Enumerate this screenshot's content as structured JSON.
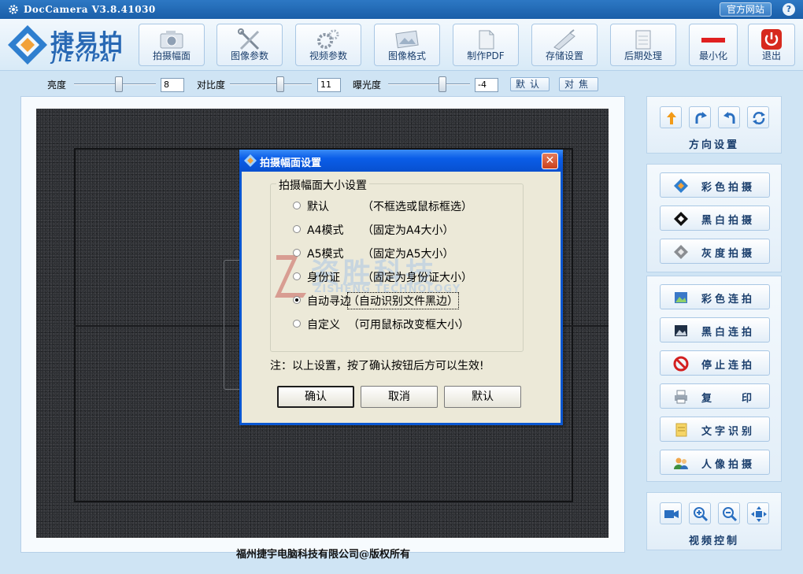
{
  "window": {
    "title": "DocCamera V3.8.41030",
    "official_site": "官方网站",
    "help": "?"
  },
  "logo": {
    "brand": "捷易拍",
    "sub": "JIEYIPAI"
  },
  "toolbar": {
    "items": [
      {
        "label": "拍摄幅面",
        "icon": "camera-icon"
      },
      {
        "label": "图像参数",
        "icon": "tools-icon"
      },
      {
        "label": "视频参数",
        "icon": "gears-icon"
      },
      {
        "label": "图像格式",
        "icon": "image-format-icon"
      },
      {
        "label": "制作PDF",
        "icon": "pdf-icon"
      },
      {
        "label": "存储设置",
        "icon": "storage-icon"
      },
      {
        "label": "后期处理",
        "icon": "notepad-icon"
      },
      {
        "label": "最小化",
        "icon": "minimize-icon"
      },
      {
        "label": "退出",
        "icon": "power-icon"
      }
    ]
  },
  "adjust": {
    "brightness": {
      "label": "亮度",
      "value": "8",
      "level": 0.55
    },
    "contrast": {
      "label": "对比度",
      "value": "11",
      "level": 0.62
    },
    "exposure": {
      "label": "曝光度",
      "value": "-4",
      "level": 0.66
    },
    "default_btn": "默认",
    "focus_btn": "对焦"
  },
  "copyright": "福州捷宇电脑科技有限公司@版权所有",
  "right_panel": {
    "direction_title": "方向设置",
    "capture": [
      {
        "label": "彩色拍摄",
        "icon": "color-capture-icon"
      },
      {
        "label": "黑白拍摄",
        "icon": "bw-capture-icon"
      },
      {
        "label": "灰度拍摄",
        "icon": "gray-capture-icon"
      }
    ],
    "actions": [
      {
        "label": "彩色连拍",
        "icon": "color-burst-icon"
      },
      {
        "label": "黑白连拍",
        "icon": "bw-burst-icon"
      },
      {
        "label": "停止连拍",
        "icon": "stop-icon"
      },
      {
        "label": "复　　印",
        "icon": "printer-icon"
      },
      {
        "label": "文字识别",
        "icon": "document-icon"
      },
      {
        "label": "人像拍摄",
        "icon": "people-icon"
      }
    ],
    "video_title": "视频控制"
  },
  "dialog": {
    "title": "拍摄幅面设置",
    "group_title": "拍摄幅面大小设置",
    "options": [
      {
        "name": "默认",
        "desc": "（不框选或鼠标框选）",
        "selected": false
      },
      {
        "name": "A4模式",
        "desc": "（固定为A4大小）",
        "selected": false
      },
      {
        "name": "A5模式",
        "desc": "（固定为A5大小）",
        "selected": false
      },
      {
        "name": "身份证",
        "desc": "（固定为身份证大小）",
        "selected": false
      },
      {
        "name": "自动寻边",
        "desc": "（自动识别文件黑边）",
        "selected": true
      },
      {
        "name": "自定义",
        "desc": "（可用鼠标改变框大小）",
        "selected": false
      }
    ],
    "note": "注：以上设置，按了确认按钮后方可以生效!",
    "ok": "确认",
    "cancel": "取消",
    "default": "默认"
  },
  "watermark": {
    "text": "资胜科技",
    "sub": "ZISHENG TECHNOLOGY"
  },
  "colors": {
    "title_bar": "#1a5ea8",
    "dialog_blue": "#0a5de8",
    "accent": "#2768b4"
  }
}
